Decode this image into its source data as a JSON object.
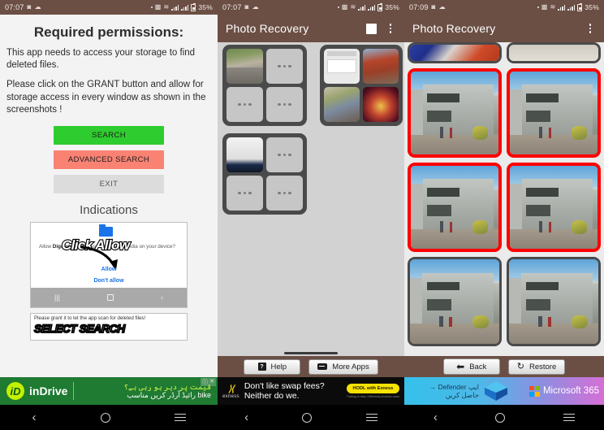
{
  "meta": {
    "accent_header": "#6b4f44",
    "selection_red": "#ff0000",
    "green_button": "#2ecc2e",
    "red_button": "#f98273"
  },
  "panels": [
    {
      "id": "permissions",
      "status_bar": {
        "time": "07:07",
        "battery": "35%",
        "icons": [
          "dot-icon",
          "vibrate-icon",
          "wifi-icon",
          "signal-icon",
          "signal-icon",
          "battery-icon"
        ]
      },
      "permission": {
        "title": "Required permissions:",
        "paragraph1": "This app needs to access your storage to find deleted files.",
        "paragraph2": "Please click on the GRANT button and allow for storage access in every window as shown in the screenshots !",
        "buttons": [
          {
            "label": "SEARCH",
            "style": "search"
          },
          {
            "label": "ADVANCED SEARCH",
            "style": "adv"
          },
          {
            "label": "EXIT",
            "style": "exit"
          }
        ]
      },
      "indications": {
        "heading": "Indications",
        "card1": {
          "overlay_text": "Click Allow",
          "dialog_text_prefix": "Allow ",
          "dialog_app_name": "Digdeep",
          "dialog_text_suffix": " to access photos and media on your device?",
          "allow_label": "Allow",
          "deny_label": "Don't allow",
          "nav_icons": [
            "recents-icon",
            "home-icon",
            "back-icon"
          ]
        },
        "card2": {
          "line1": "Please grant it to let the app scan for deleted files!",
          "line2": "SELECT SEARCH"
        }
      },
      "ad": {
        "type": "indrive",
        "logo_letter": "iD",
        "brand": "inDrive",
        "urdu_line1": "قیمت پر دیر ہو رہی ہے؟",
        "urdu_line2": "bike رائیڈ آرڈر کریں مناسب",
        "close_icons": [
          "info-icon",
          "close-icon"
        ]
      },
      "sysnav": {
        "back": "back-icon",
        "home": "home-icon",
        "recents": "recents-icon"
      }
    },
    {
      "id": "folders",
      "status_bar": {
        "time": "07:07",
        "battery": "35%"
      },
      "appbar": {
        "title": "Photo Recovery",
        "checkbox": "select-all-checkbox",
        "menu": "overflow-menu-icon"
      },
      "folder_cards": [
        {
          "name": "folder-card-1",
          "thumbs": [
            "road-photo",
            "more",
            "more",
            "more"
          ]
        },
        {
          "name": "folder-card-2",
          "thumbs": [
            "document-photo",
            "brick-wall-photo",
            "man-photo",
            "festival-photo"
          ]
        },
        {
          "name": "folder-card-3",
          "thumbs": [
            "screenshot-photo",
            "more",
            "more",
            "more"
          ]
        }
      ],
      "more_indicator": "•••",
      "buttons": [
        {
          "label": "Help",
          "icon": "help-icon"
        },
        {
          "label": "More Apps",
          "icon": "more-apps-icon"
        }
      ],
      "ad": {
        "type": "exness",
        "brand_mark": "⟩⟨",
        "brand_name": "exness",
        "line1": "Don't like swap fees?",
        "line2": "Neither do we.",
        "cta": "HODL with Exness",
        "disclaimer": "Trading is risky. Differently involves costs"
      },
      "sysnav": {
        "back": "back-icon",
        "home": "home-icon",
        "recents": "recents-icon"
      }
    },
    {
      "id": "recovery-results",
      "status_bar": {
        "time": "07:09",
        "battery": "35%"
      },
      "appbar": {
        "title": "Photo Recovery",
        "menu": "overflow-menu-icon"
      },
      "photo_grid": [
        {
          "name": "photo-partial-kid",
          "selected": false,
          "partial": true
        },
        {
          "name": "photo-partial-wall",
          "selected": false,
          "partial": true
        },
        {
          "name": "photo-house-1",
          "selected": true
        },
        {
          "name": "photo-house-2",
          "selected": true
        },
        {
          "name": "photo-house-3",
          "selected": true
        },
        {
          "name": "photo-house-4",
          "selected": true
        },
        {
          "name": "photo-house-5",
          "selected": false
        },
        {
          "name": "photo-house-6",
          "selected": false
        }
      ],
      "buttons": [
        {
          "label": "Back",
          "icon": "arrow-left-icon"
        },
        {
          "label": "Restore",
          "icon": "restore-icon"
        }
      ],
      "ad": {
        "type": "microsoft",
        "urdu_line1": "ایپ Defender →",
        "urdu_line2": "حاصل کریں",
        "brand": "Microsoft 365",
        "logo": "microsoft-logo-icon"
      },
      "sysnav": {
        "back": "back-icon",
        "home": "home-icon",
        "recents": "recents-icon"
      }
    }
  ]
}
